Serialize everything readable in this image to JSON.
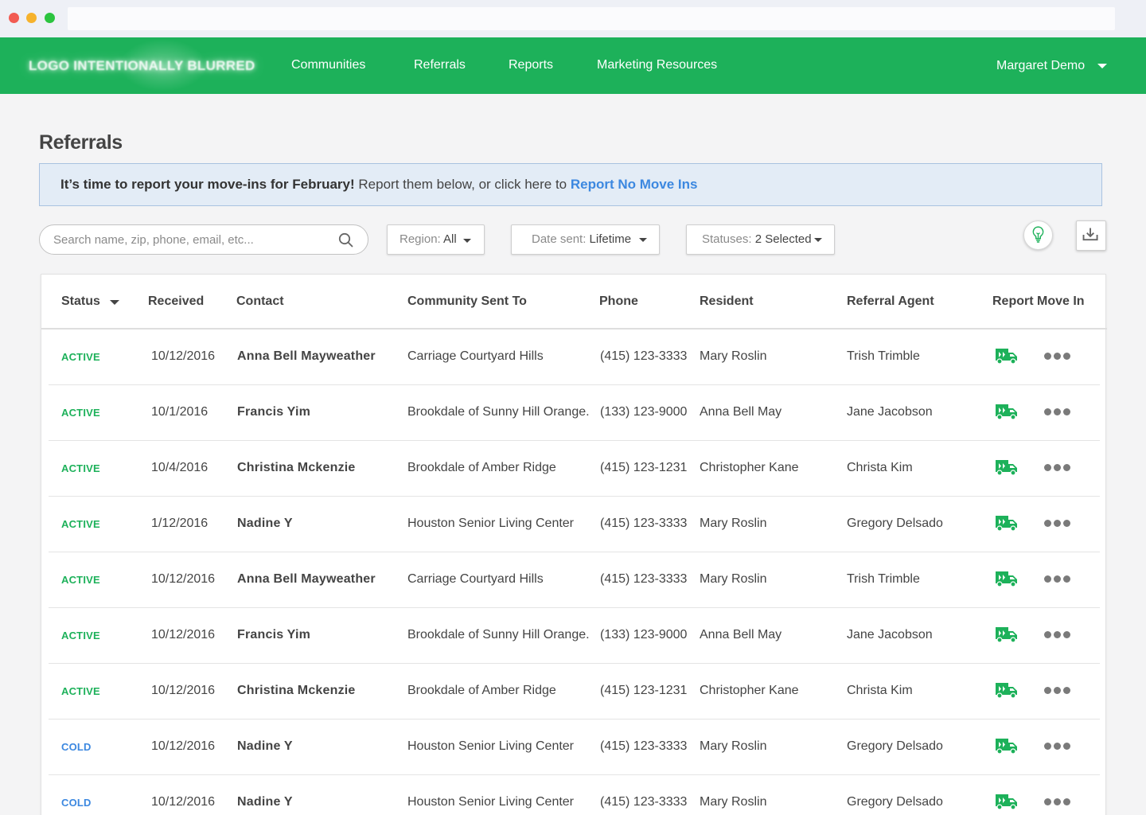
{
  "nav": {
    "logo_text": "LOGO INTENTIONALLY BLURRED",
    "links": [
      "Communities",
      "Referrals",
      "Reports",
      "Marketing Resources"
    ],
    "user_name": "Margaret Demo",
    "accent_color": "#1db15a"
  },
  "page": {
    "title": "Referrals"
  },
  "banner": {
    "bold_text": "It’s time to report your move-ins for February!",
    "text": "Report them below, or click here to",
    "link_text": "Report No Move Ins"
  },
  "filters": {
    "search_placeholder": "Search name, zip, phone, email, etc...",
    "region_label": "Region:",
    "region_value": "All",
    "date_label": "Date sent:",
    "date_value": "Lifetime",
    "status_label": "Statuses:",
    "status_value": "2 Selected"
  },
  "icons": {
    "search": "search-icon",
    "bulb": "lightbulb-icon",
    "download": "download-icon",
    "truck": "moving-truck-icon",
    "more": "more-options-icon"
  },
  "table": {
    "columns": [
      "Status",
      "Received",
      "Contact",
      "Community Sent To",
      "Phone",
      "Resident",
      "Referral Agent",
      "Report Move In"
    ],
    "rows": [
      {
        "status": "ACTIVE",
        "received": "10/12/2016",
        "contact": "Anna Bell Mayweather",
        "community": "Carriage Courtyard Hills",
        "phone": "(415) 123-3333",
        "resident": "Mary Roslin",
        "agent": "Trish Trimble"
      },
      {
        "status": "ACTIVE",
        "received": "10/1/2016",
        "contact": "Francis Yim",
        "community": "Brookdale of Sunny Hill Orange...",
        "phone": "(133) 123-9000",
        "resident": "Anna Bell May",
        "agent": "Jane Jacobson"
      },
      {
        "status": "ACTIVE",
        "received": "10/4/2016",
        "contact": "Christina Mckenzie",
        "community": "Brookdale of Amber Ridge",
        "phone": "(415) 123-1231",
        "resident": "Christopher Kane",
        "agent": "Christa Kim"
      },
      {
        "status": "ACTIVE",
        "received": "1/12/2016",
        "contact": "Nadine Y",
        "community": "Houston Senior Living Center",
        "phone": "(415) 123-3333",
        "resident": "Mary Roslin",
        "agent": "Gregory Delsado"
      },
      {
        "status": "ACTIVE",
        "received": "10/12/2016",
        "contact": "Anna Bell Mayweather",
        "community": "Carriage Courtyard Hills",
        "phone": "(415) 123-3333",
        "resident": "Mary Roslin",
        "agent": "Trish Trimble"
      },
      {
        "status": "ACTIVE",
        "received": "10/12/2016",
        "contact": "Francis Yim",
        "community": "Brookdale of Sunny Hill Orange...",
        "phone": "(133) 123-9000",
        "resident": "Anna Bell May",
        "agent": "Jane Jacobson"
      },
      {
        "status": "ACTIVE",
        "received": "10/12/2016",
        "contact": "Christina Mckenzie",
        "community": "Brookdale of Amber Ridge",
        "phone": "(415) 123-1231",
        "resident": "Christopher Kane",
        "agent": "Christa Kim"
      },
      {
        "status": "COLD",
        "received": "10/12/2016",
        "contact": "Nadine Y",
        "community": "Houston Senior Living Center",
        "phone": "(415) 123-3333",
        "resident": "Mary Roslin",
        "agent": "Gregory Delsado"
      },
      {
        "status": "COLD",
        "received": "10/12/2016",
        "contact": "Nadine Y",
        "community": "Houston Senior Living Center",
        "phone": "(415) 123-3333",
        "resident": "Mary Roslin",
        "agent": "Gregory Delsado"
      }
    ]
  }
}
